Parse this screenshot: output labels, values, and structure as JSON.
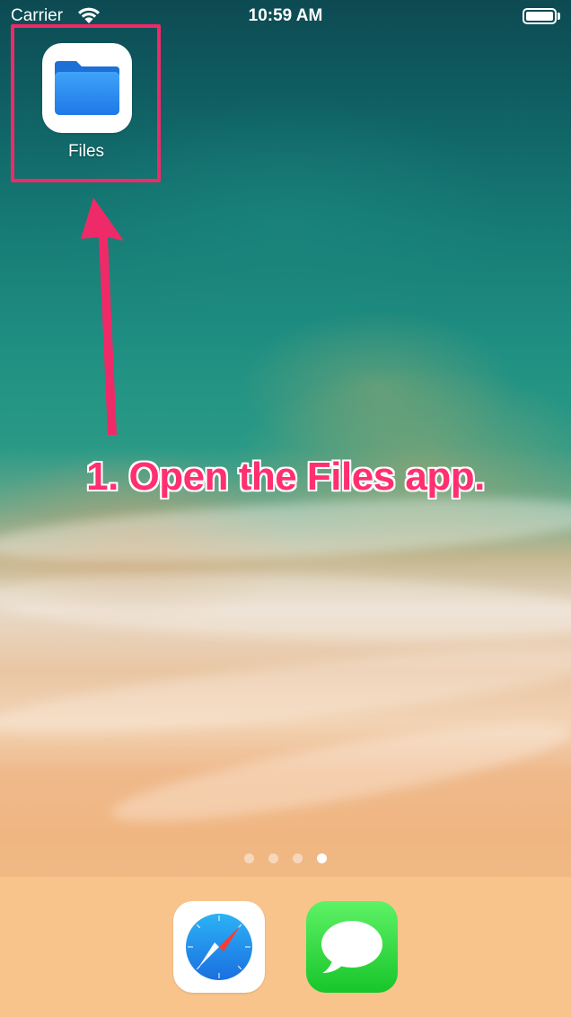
{
  "status_bar": {
    "carrier": "Carrier",
    "time": "10:59 AM",
    "wifi_icon": "wifi-icon",
    "battery_icon": "battery-icon"
  },
  "home_screen": {
    "apps": [
      {
        "label": "Files",
        "icon": "folder-icon",
        "accent": "#2f8df2"
      }
    ],
    "page_indicator": {
      "pages": 4,
      "current": 4
    }
  },
  "annotation": {
    "callout": "1. Open the Files app.",
    "color": "#ef2a68"
  },
  "dock": {
    "apps": [
      {
        "name": "safari",
        "icon": "safari-compass-icon"
      },
      {
        "name": "messages",
        "icon": "speech-bubble-icon"
      }
    ]
  }
}
